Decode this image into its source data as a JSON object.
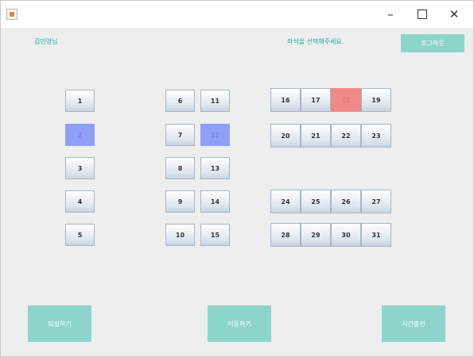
{
  "window": {
    "minimize": "–",
    "close": "✕"
  },
  "header": {
    "user_label": "김민영님",
    "status_text": "좌석을 선택해주세요.",
    "logout_label": "로그아웃"
  },
  "seats": [
    "1",
    "2",
    "3",
    "4",
    "5",
    "6",
    "7",
    "8",
    "9",
    "10",
    "11",
    "12",
    "13",
    "14",
    "15",
    "16",
    "17",
    "18",
    "19",
    "20",
    "21",
    "22",
    "23",
    "24",
    "25",
    "26",
    "27",
    "28",
    "29",
    "30",
    "31"
  ],
  "seat_states": {
    "selected": [
      "2",
      "12"
    ],
    "taken": [
      "18"
    ]
  },
  "bottom": {
    "left_label": "퇴실하기",
    "center_label": "이동하기",
    "right_label": "시간충전"
  },
  "colors": {
    "accent": "#8dd5cb",
    "accent_text": "#1aa7a0",
    "selected_seat": "#8f9ff6",
    "taken_seat": "#f08988"
  }
}
